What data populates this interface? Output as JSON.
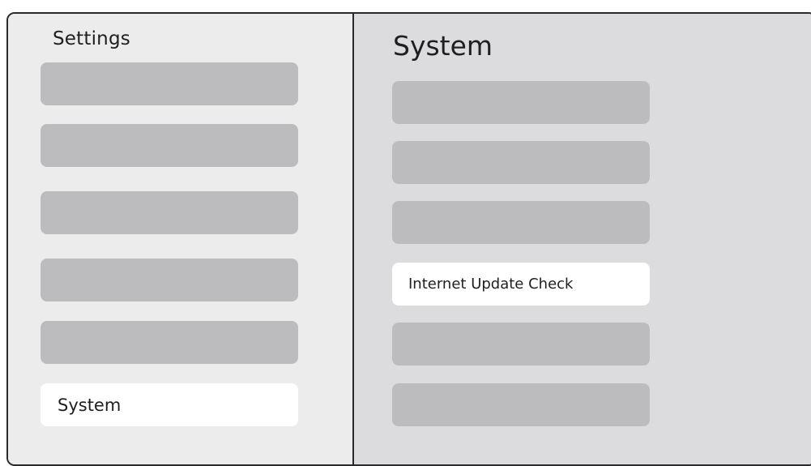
{
  "sidebar": {
    "title": "Settings",
    "items": [
      {
        "label": ""
      },
      {
        "label": ""
      },
      {
        "label": ""
      },
      {
        "label": ""
      },
      {
        "label": ""
      },
      {
        "label": "System",
        "selected": true
      }
    ]
  },
  "main": {
    "title": "System",
    "options": [
      {
        "label": ""
      },
      {
        "label": ""
      },
      {
        "label": ""
      },
      {
        "label": "Internet Update Check",
        "selected": true
      },
      {
        "label": ""
      },
      {
        "label": ""
      }
    ]
  },
  "colors": {
    "window_border": "#2a2a2a",
    "left_panel_bg": "#ececec",
    "right_panel_bg": "#dcdbdd",
    "placeholder_item_bg": "#bcbbbe",
    "selected_item_bg": "#ffffff",
    "text": "#1f1f1f"
  }
}
